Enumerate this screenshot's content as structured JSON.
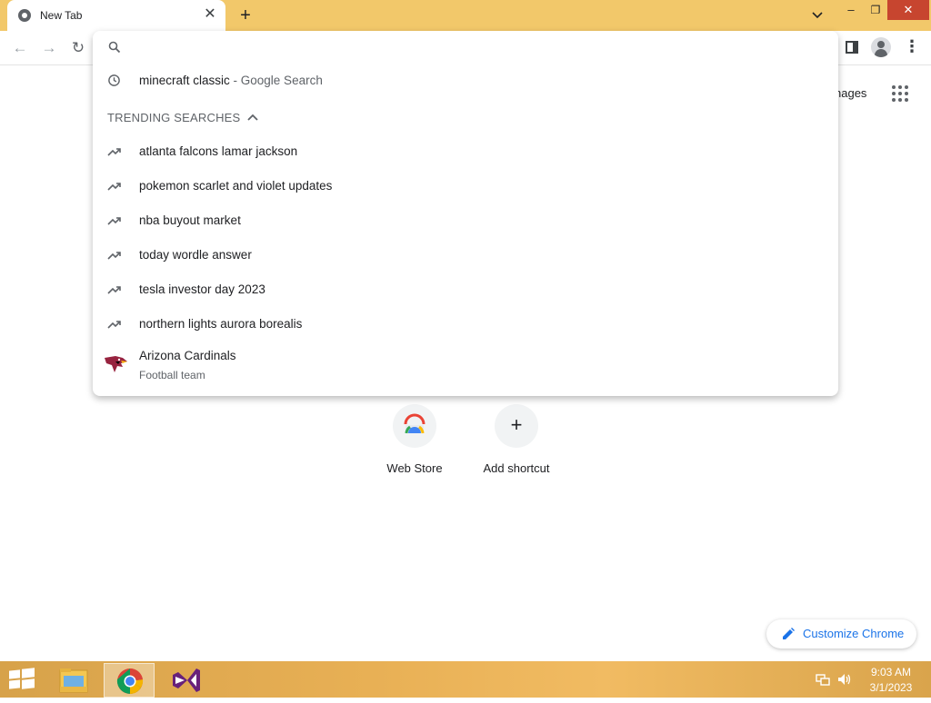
{
  "browser": {
    "tab": {
      "title": "New Tab",
      "close": "✕"
    },
    "new_tab": "+",
    "window": {
      "minimize": "–",
      "maximize": "❐",
      "close": "✕",
      "tab_search": "⌄"
    },
    "nav": {
      "back": "←",
      "forward": "→",
      "reload": "↻",
      "menu": "⋮"
    }
  },
  "ntp": {
    "images_link": "nages",
    "shortcuts": [
      {
        "label": "Web Store"
      },
      {
        "label": "Add shortcut",
        "icon": "+"
      }
    ],
    "customize_label": "Customize Chrome"
  },
  "omnibox": {
    "value": "",
    "history": {
      "query": "minecraft classic",
      "suffix": " - Google Search"
    },
    "trending_header": "TRENDING SEARCHES",
    "trending": [
      "atlanta falcons lamar jackson",
      "pokemon scarlet and violet updates",
      "nba buyout market",
      "today wordle answer",
      "tesla investor day 2023",
      "northern lights aurora borealis"
    ],
    "entity": {
      "name": "Arizona Cardinals",
      "subtitle": "Football team"
    }
  },
  "taskbar": {
    "time": "9:03 AM",
    "date": "3/1/2023"
  },
  "colors": {
    "titlebar": "#f2c86a",
    "close_button": "#c7452f",
    "link_blue": "#1a73e8"
  },
  "icons": [
    "chrome-icon",
    "search-icon",
    "history-icon",
    "trending-icon",
    "cardinals-logo",
    "pencil-icon",
    "apps-icon",
    "windows-start-icon",
    "file-explorer-icon",
    "visual-studio-icon"
  ]
}
